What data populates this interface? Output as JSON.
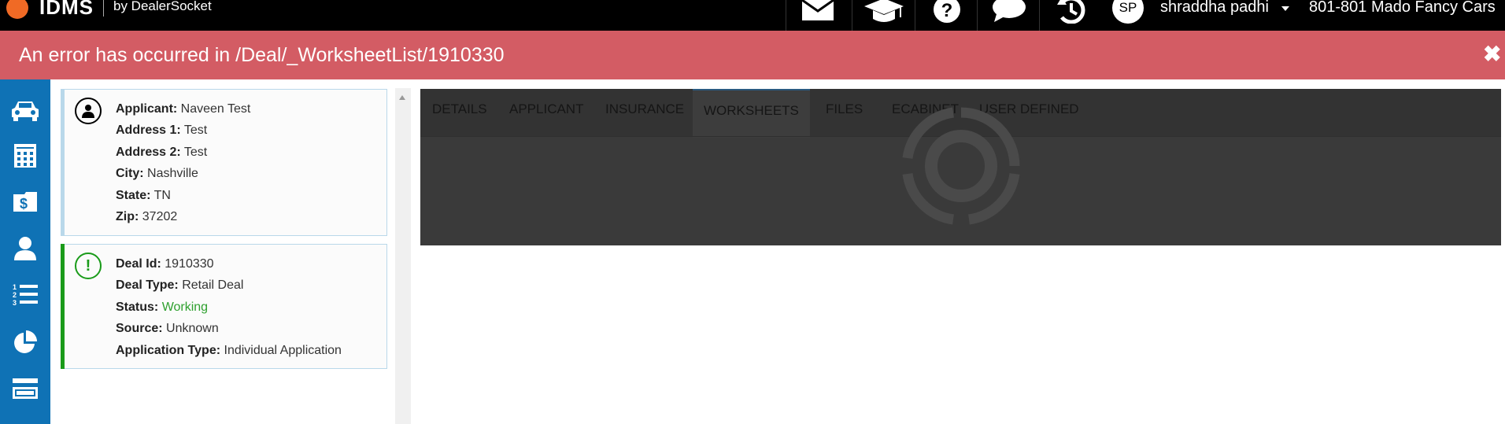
{
  "header": {
    "brand": "IDMS",
    "brand_by": "by DealerSocket",
    "nav_icons": [
      "mail-icon",
      "graduation-cap-icon",
      "help-icon",
      "chat-icon",
      "history-icon"
    ],
    "user_initials": "SP",
    "user_name": "shraddha padhi",
    "dealer": "801-801 Mado Fancy Cars"
  },
  "error": {
    "message": "An error has occurred in /Deal/_WorksheetList/1910330",
    "close_glyph": "✖"
  },
  "sidebar": {
    "items": [
      "car-icon",
      "calculator-icon",
      "money-icon",
      "person-icon",
      "numbered-list-icon",
      "pie-chart-icon",
      "credit-card-icon"
    ]
  },
  "applicant_card": {
    "icon": "person-icon",
    "rows": [
      {
        "label": "Applicant:",
        "value": "Naveen Test"
      },
      {
        "label": "Address 1:",
        "value": "Test"
      },
      {
        "label": "Address 2:",
        "value": "Test"
      },
      {
        "label": "City:",
        "value": "Nashville"
      },
      {
        "label": "State:",
        "value": "TN"
      },
      {
        "label": "Zip:",
        "value": "37202"
      }
    ]
  },
  "deal_card": {
    "icon": "exclamation-icon",
    "rows": [
      {
        "label": "Deal Id:",
        "value": "1910330"
      },
      {
        "label": "Deal Type:",
        "value": "Retail Deal"
      },
      {
        "label": "Status:",
        "value": "Working"
      },
      {
        "label": "Source:",
        "value": "Unknown"
      },
      {
        "label": "Application Type:",
        "value": "Individual Application"
      }
    ]
  },
  "tabs": [
    "DETAILS",
    "APPLICANT",
    "INSURANCE",
    "WORKSHEETS",
    "FILES",
    "ECABINET",
    "USER DEFINED"
  ],
  "active_tab": "WORKSHEETS",
  "colors": {
    "error_bg": "#d35c64",
    "sidebar_bg": "#0f72b5",
    "status_working": "#2ea02e",
    "deal_accent": "#1a9b1a",
    "applicant_accent": "#b9d8ea"
  }
}
